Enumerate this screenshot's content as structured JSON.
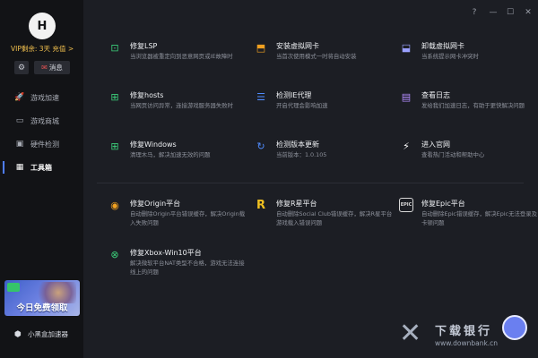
{
  "sidebar": {
    "logo_text": "H",
    "vip_text": "VIP剩余: 3天 充值 >",
    "message_label": "消息",
    "nav": [
      {
        "label": "游戏加速",
        "icon": "rocket-icon",
        "glyph": "🚀"
      },
      {
        "label": "游戏商城",
        "icon": "shop-icon",
        "glyph": "▭"
      },
      {
        "label": "硬件检测",
        "icon": "monitor-icon",
        "glyph": "▣"
      },
      {
        "label": "工具箱",
        "icon": "grid-icon",
        "glyph": "▦"
      }
    ],
    "promo_text": "今日免费领取",
    "brand_name": "小黑盒加速器"
  },
  "tools": [
    {
      "title": "修复LSP",
      "desc": "当浏览器被重定向到恶意网页或IE故障时",
      "icon": "lsp-repair-icon",
      "glyph": "⊡",
      "color": "#3ccf7a"
    },
    {
      "title": "安装虚拟网卡",
      "desc": "当首次使用模式一时将自动安装",
      "icon": "install-nic-icon",
      "glyph": "⬒",
      "color": "#f0a020"
    },
    {
      "title": "卸载虚拟网卡",
      "desc": "当系统提示网卡冲突时",
      "icon": "uninstall-nic-icon",
      "glyph": "⬓",
      "color": "#9aa0ff"
    },
    {
      "title": "修复hosts",
      "desc": "当网页访问异常，连接游戏服务器失败时",
      "icon": "hosts-repair-icon",
      "glyph": "⊞",
      "color": "#3ccf7a"
    },
    {
      "title": "检测IE代理",
      "desc": "开启代理会影响加速",
      "icon": "ie-proxy-icon",
      "glyph": "☰",
      "color": "#4f8cff"
    },
    {
      "title": "查看日志",
      "desc": "发给我们加速日志，有助于更快解决问题",
      "icon": "log-icon",
      "glyph": "▤",
      "color": "#b48cff"
    },
    {
      "title": "修复Windows",
      "desc": "清理木马，解决加速无效的问题",
      "icon": "windows-icon",
      "glyph": "⊞",
      "color": "#3ccf7a"
    },
    {
      "title": "检测版本更新",
      "desc": "当前版本：1.0.105",
      "icon": "update-icon",
      "glyph": "↻",
      "color": "#4f8cff"
    },
    {
      "title": "进入官网",
      "desc": "查看热门活动和帮助中心",
      "icon": "website-icon",
      "glyph": "⚡",
      "color": "#ffffff"
    },
    {
      "title": "修复Origin平台",
      "desc": "自动删除Origin平台错误缓存，解决Origin载入失败问题",
      "icon": "origin-icon",
      "glyph": "◉",
      "color": "#f0a020"
    },
    {
      "title": "修复R星平台",
      "desc": "自动删除Social Club错误缓存，解决R星平台游戏载入错误问题",
      "icon": "rockstar-icon",
      "glyph": "R",
      "color": "#f0c020"
    },
    {
      "title": "修复Epic平台",
      "desc": "自动删除Epic错误缓存，解决Epic无法登录及卡顿问题",
      "icon": "epic-icon",
      "glyph": "EPIC",
      "color": "#d8d8d8"
    },
    {
      "title": "修复Xbox-Win10平台",
      "desc": "解决微软平台NAT类型不合格，游戏无法连接线上的问题",
      "icon": "xbox-icon",
      "glyph": "⊗",
      "color": "#3ccf7a"
    }
  ],
  "watermark": {
    "name": "下载银行",
    "url": "www.downbank.cn"
  }
}
